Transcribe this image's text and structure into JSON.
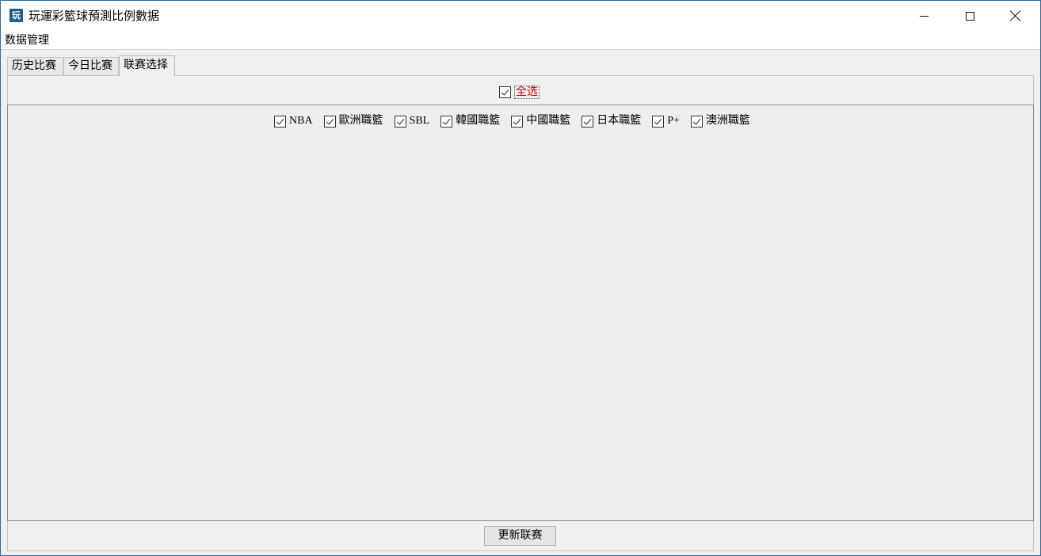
{
  "window": {
    "title": "玩運彩籃球預測比例數据",
    "icon_text": "玩",
    "controls": {
      "minimize": "minimize-icon",
      "maximize": "maximize-icon",
      "close": "close-icon"
    }
  },
  "menubar": {
    "items": [
      {
        "label": "数据管理"
      }
    ]
  },
  "tabs": [
    {
      "label": "历史比赛",
      "active": false
    },
    {
      "label": "今日比赛",
      "active": false
    },
    {
      "label": "联赛选择",
      "active": true
    }
  ],
  "league_select": {
    "select_all": {
      "label": "全选",
      "checked": true,
      "color": "#d80000"
    },
    "leagues": [
      {
        "label": "NBA",
        "checked": true
      },
      {
        "label": "歐洲職籃",
        "checked": true
      },
      {
        "label": "SBL",
        "checked": true
      },
      {
        "label": "韓國職籃",
        "checked": true
      },
      {
        "label": "中國職籃",
        "checked": true
      },
      {
        "label": "日本職籃",
        "checked": true
      },
      {
        "label": "P+",
        "checked": true
      },
      {
        "label": "澳洲職籃",
        "checked": true
      }
    ],
    "update_button": "更新联赛"
  }
}
